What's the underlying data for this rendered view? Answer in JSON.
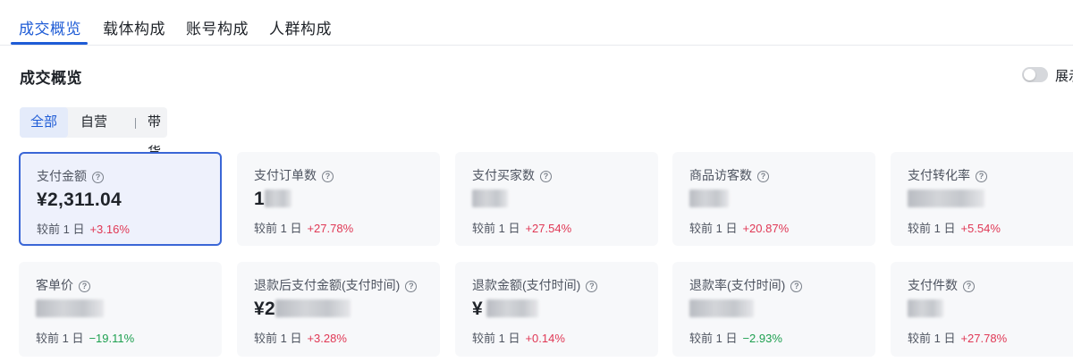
{
  "tabs": [
    {
      "label": "成交概览",
      "active": true
    },
    {
      "label": "载体构成",
      "active": false
    },
    {
      "label": "账号构成",
      "active": false
    },
    {
      "label": "人群构成",
      "active": false
    }
  ],
  "section": {
    "title": "成交概览"
  },
  "toggle": {
    "label": "展示",
    "on": false
  },
  "filter": {
    "options": [
      "全部",
      "自营",
      "带货"
    ],
    "selected": "全部"
  },
  "compare_label": "较前 1 日",
  "cards": [
    {
      "label": "支付金额",
      "value": "¥2,311.04",
      "delta": "+3.16%",
      "direction": "up",
      "selected": true
    },
    {
      "label": "支付订单数",
      "value": "1",
      "delta": "+27.78%",
      "direction": "up"
    },
    {
      "label": "支付买家数",
      "value": "",
      "delta": "+27.54%",
      "direction": "up"
    },
    {
      "label": "商品访客数",
      "value": "",
      "delta": "+20.87%",
      "direction": "up"
    },
    {
      "label": "支付转化率",
      "value": "",
      "delta": "+5.54%",
      "direction": "up"
    },
    {
      "label": "客单价",
      "value": "",
      "delta": "−19.11%",
      "direction": "down"
    },
    {
      "label": "退款后支付金额(支付时间)",
      "value": "¥2",
      "delta": "+3.28%",
      "direction": "up"
    },
    {
      "label": "退款金额(支付时间)",
      "value": "¥",
      "delta": "+0.14%",
      "direction": "up"
    },
    {
      "label": "退款率(支付时间)",
      "value": "",
      "delta": "−2.93%",
      "direction": "down"
    },
    {
      "label": "支付件数",
      "value": "",
      "delta": "+27.78%",
      "direction": "up"
    }
  ],
  "colors": {
    "accent": "#1f5cd6",
    "up": "#e03855",
    "down": "#1ea050",
    "card_bg": "#f7f8fa"
  }
}
